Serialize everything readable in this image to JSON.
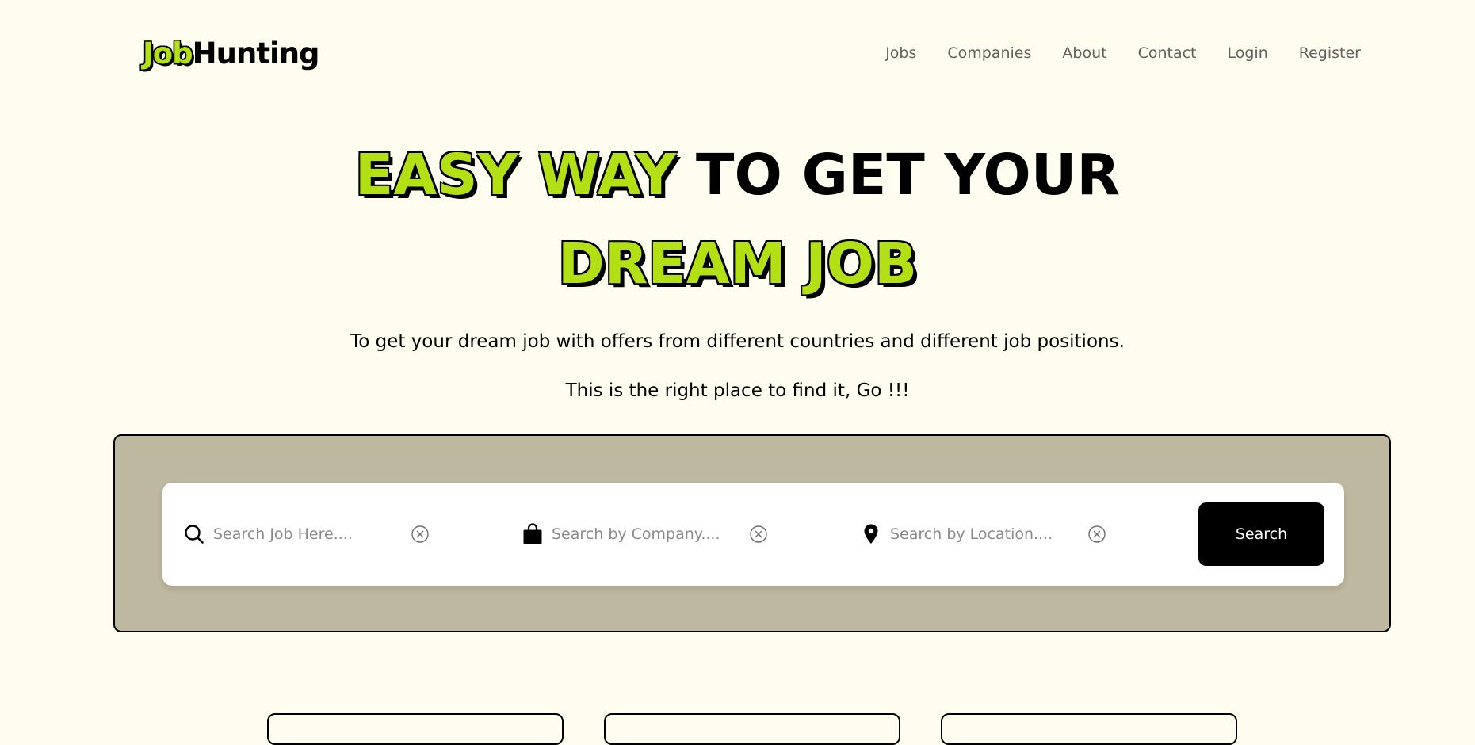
{
  "logo": {
    "accent": "Job",
    "rest": "Hunting"
  },
  "nav": {
    "items": [
      "Jobs",
      "Companies",
      "About",
      "Contact",
      "Login",
      "Register"
    ]
  },
  "hero": {
    "title_highlight_1": "EASY WAY",
    "title_dark": " TO GET YOUR",
    "title_highlight_2": "DREAM JOB",
    "subtitle_1": "To get your dream job with offers from different countries and different job positions.",
    "subtitle_2": "This is the right place to find it, Go !!!"
  },
  "search": {
    "job_placeholder": "Search Job Here....",
    "company_placeholder": "Search by Company....",
    "location_placeholder": "Search by Location....",
    "button_label": "Search"
  },
  "colors": {
    "accent": "#b3e014",
    "background": "#fffdef",
    "panel": "#bfb8a0",
    "button": "#000000"
  }
}
